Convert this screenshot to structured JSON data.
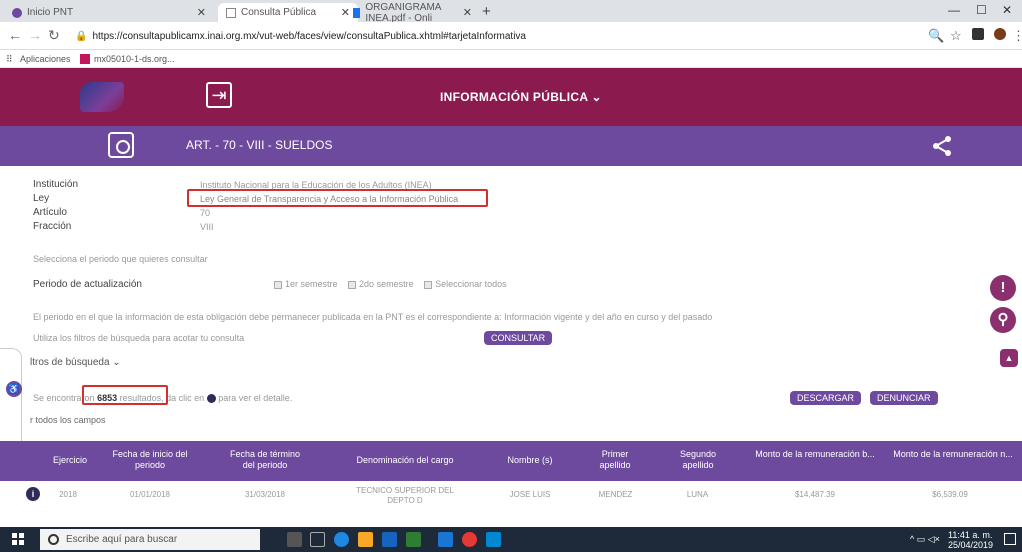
{
  "browser": {
    "tabs": [
      {
        "label": "Inicio PNT"
      },
      {
        "label": "Consulta Pública"
      },
      {
        "label": "ORGANIGRAMA INEA.pdf - Onli"
      }
    ],
    "url": "https://consultapublicamx.inai.org.mx/vut-web/faces/view/consultaPublica.xhtml#tarjetaInformativa",
    "bookmarks": [
      "Aplicaciones",
      "mx05010-1-ds.org..."
    ]
  },
  "header": {
    "menu_label": "INFORMACIÓN PÚBLICA ⌄",
    "section_title": "ART. - 70 - VIII - SUELDOS"
  },
  "info": {
    "labels": [
      "Institución",
      "Ley",
      "Artículo",
      "Fracción"
    ],
    "values": [
      "Instituto Nacional para la Educación de los Adultos (INEA)",
      "Ley General de Transparencia y Acceso a la Información Pública",
      "70",
      "VIII"
    ]
  },
  "period": {
    "prompt": "Selecciona el periodo que quieres consultar",
    "label": "Periodo de actualización",
    "options": [
      "1er semestre",
      "2do semestre",
      "Seleccionar todos"
    ]
  },
  "notes": {
    "permanence": "El periodo en el que la información de esta obligación debe permanecer publicada en la PNT es el correspondiente a: Información vigente y del año en curso y del pasado",
    "filters_hint": "Utiliza los filtros de búsqueda para acotar tu consulta",
    "consult_btn": "CONSULTAR",
    "filters_toggle": "ltros de búsqueda ⌄",
    "results_prefix": "Se encontraron",
    "results_count": "6853",
    "results_suffix": "resultados, da clic en",
    "results_tail": "para ver el detalle.",
    "all_fields": "r todos los campos",
    "download_btn": "DESCARGAR",
    "report_btn": "DENUNCIAR"
  },
  "table": {
    "headers": [
      "Ejercicio",
      "Fecha de inicio del periodo",
      "Fecha de término del periodo",
      "Denominación del cargo",
      "Nombre (s)",
      "Primer apellido",
      "Segundo apellido",
      "Monto de la remuneración b...",
      "Monto de la remuneración n..."
    ],
    "rows": [
      [
        "2018",
        "01/01/2018",
        "31/03/2018",
        "TECNICO SUPERIOR DEL DEPTO D",
        "JOSE LUIS",
        "MENDEZ",
        "LUNA",
        "$14,487.39",
        "$6,539.09"
      ]
    ]
  },
  "taskbar": {
    "search_placeholder": "Escribe aquí para buscar",
    "time": "11:41 a. m.",
    "date": "25/04/2019"
  },
  "colors": {
    "brand_dark": "#8b1a4f",
    "brand_purple": "#6e4a9e",
    "highlight": "#d32f2f"
  }
}
